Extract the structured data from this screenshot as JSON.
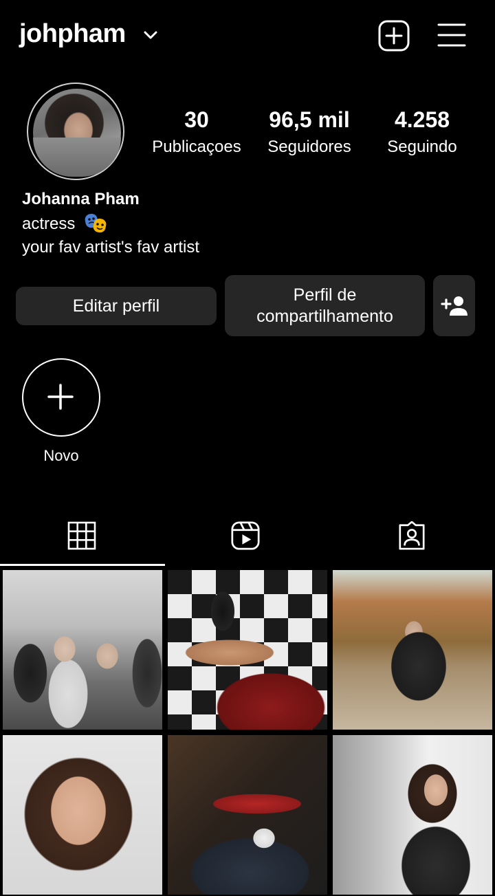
{
  "header": {
    "username": "johpham"
  },
  "profile": {
    "stats": [
      {
        "value": "30",
        "label": "Publicaçoes"
      },
      {
        "value": "96,5 mil",
        "label": "Seguidores"
      },
      {
        "value": "4.258",
        "label": "Seguindo"
      }
    ],
    "full_name": "Johanna Pham",
    "bio_line1": "actress",
    "bio_line2": "your fav artist's fav artist"
  },
  "buttons": {
    "edit": "Editar perfil",
    "share": "Perfil de compartilhamento"
  },
  "highlights": {
    "new_label": "Novo"
  },
  "tabs": [
    "grid",
    "reels",
    "tagged"
  ],
  "colors": {
    "background": "#000000",
    "button_bg": "#262626",
    "text": "#ffffff"
  }
}
